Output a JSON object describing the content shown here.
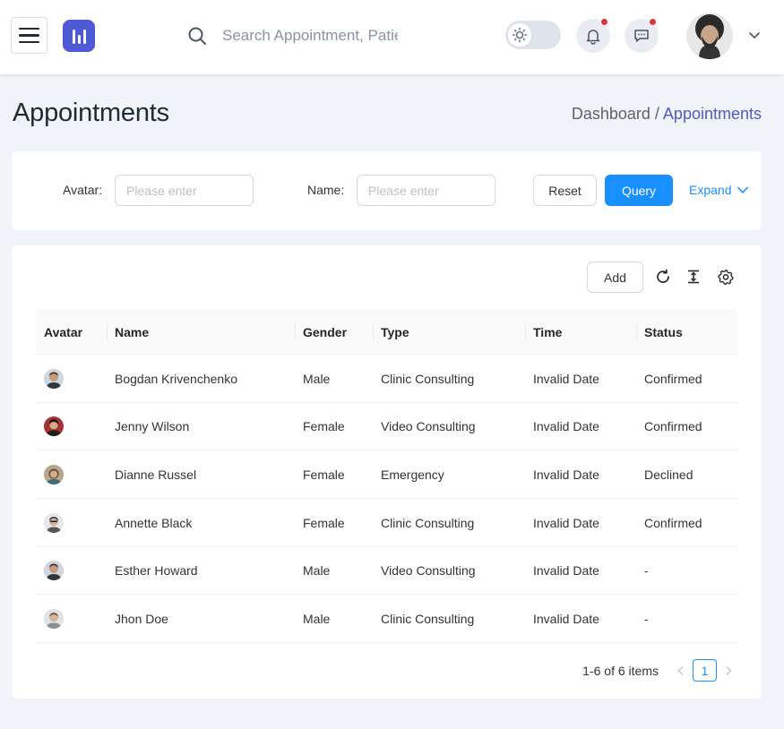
{
  "header": {
    "search_placeholder": "Search Appointment, Patient or etc",
    "notifications_has_dot": true,
    "messages_has_dot": true
  },
  "page": {
    "title": "Appointments",
    "breadcrumb": {
      "parent": "Dashboard /",
      "current": "Appointments"
    }
  },
  "filters": {
    "avatar_label": "Avatar",
    "avatar_placeholder": "Please enter",
    "name_label": "Name",
    "name_placeholder": "Please enter",
    "reset_label": "Reset",
    "query_label": "Query",
    "expand_label": "Expand"
  },
  "toolbar": {
    "add_label": "Add"
  },
  "table": {
    "columns": [
      "Avatar",
      "Name",
      "Gender",
      "Type",
      "Time",
      "Status"
    ],
    "rows": [
      {
        "name": "Bogdan Krivenchenko",
        "gender": "Male",
        "type": "Clinic Consulting",
        "time": "Invalid Date",
        "status": "Confirmed"
      },
      {
        "name": "Jenny Wilson",
        "gender": "Female",
        "type": "Video Consulting",
        "time": "Invalid Date",
        "status": "Confirmed"
      },
      {
        "name": "Dianne Russel",
        "gender": "Female",
        "type": "Emergency",
        "time": "Invalid Date",
        "status": "Declined"
      },
      {
        "name": "Annette Black",
        "gender": "Female",
        "type": "Clinic Consulting",
        "time": "Invalid Date",
        "status": "Confirmed"
      },
      {
        "name": "Esther Howard",
        "gender": "Male",
        "type": "Video Consulting",
        "time": "Invalid Date",
        "status": "-"
      },
      {
        "name": "Jhon Doe",
        "gender": "Male",
        "type": "Clinic Consulting",
        "time": "Invalid Date",
        "status": "-"
      }
    ]
  },
  "pagination": {
    "summary": "1-6 of 6 items",
    "current_page": "1"
  },
  "colors": {
    "primary": "#1890ff",
    "brand": "#4f5bd5",
    "breadcrumb_active": "#4b5bc7",
    "notification_dot": "#e0323d",
    "page_bg": "#f0f3f8"
  }
}
